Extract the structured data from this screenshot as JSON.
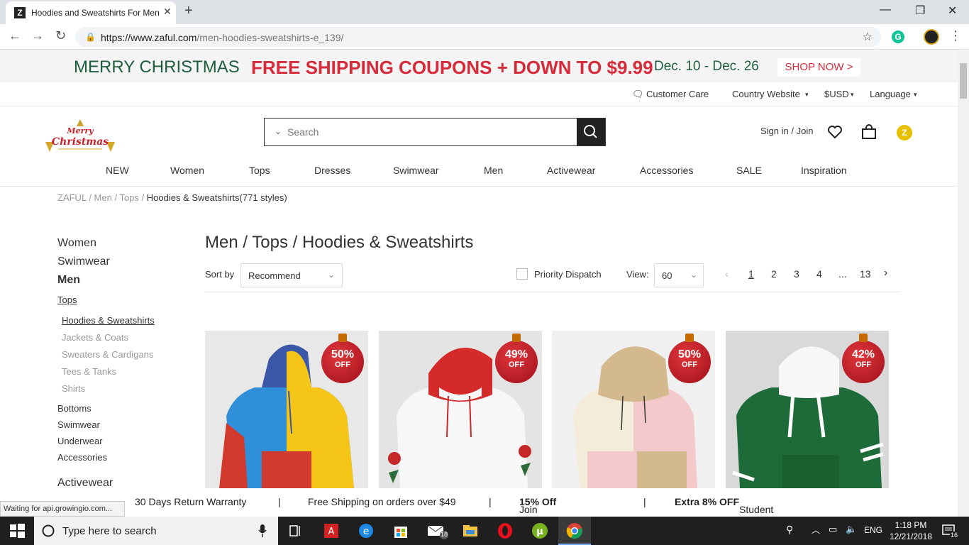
{
  "browser": {
    "tab_title": "Hoodies and Sweatshirts For Men",
    "tab_favicon": "Z",
    "url_host": "https://www.zaful.com",
    "url_path": "/men-hoodies-sweatshirts-e_139/",
    "extension_grammarly": "G"
  },
  "promo": {
    "greeting": "MERRY CHRISTMAS",
    "offer": "FREE SHIPPING COUPONS + DOWN TO $9.99",
    "dates": "Dec. 10 - Dec. 26",
    "cta": "SHOP NOW >"
  },
  "utility": {
    "customer_care": "Customer Care",
    "country": "Country Website",
    "currency": "$USD",
    "language": "Language"
  },
  "logo_text": "Merry Christmas",
  "search": {
    "placeholder": "Search"
  },
  "account": {
    "signin": "Sign in / Join",
    "points_icon": "Z"
  },
  "nav": [
    "NEW",
    "Women",
    "Tops",
    "Dresses",
    "Swimwear",
    "Men",
    "Activewear",
    "Accessories",
    "SALE",
    "Inspiration"
  ],
  "breadcrumb": {
    "home": "ZAFUL",
    "sep": " / ",
    "level1": "Men",
    "level2": "Tops",
    "current": "Hoodies & Sweatshirts(771 styles)"
  },
  "sidebar": {
    "top": [
      "Women",
      "Swimwear",
      "Men"
    ],
    "tops": "Tops",
    "tops_children": [
      "Hoodies & Sweatshirts",
      "Jackets & Coats",
      "Sweaters & Cardigans",
      "Tees & Tanks",
      "Shirts"
    ],
    "others": [
      "Bottoms",
      "Swimwear",
      "Underwear",
      "Accessories"
    ],
    "activewear": "Activewear"
  },
  "heading": "Men / Tops / Hoodies & Sweatshirts",
  "controls": {
    "sort_label": "Sort by",
    "sort_value": "Recommend",
    "priority_dispatch": "Priority Dispatch",
    "view_label": "View:",
    "view_value": "60"
  },
  "pagination": {
    "pages": [
      "1",
      "2",
      "3",
      "4",
      "...",
      "13"
    ],
    "current": "1"
  },
  "products": [
    {
      "discount": "50%",
      "off": "OFF",
      "colors": [
        "#e8e8e8",
        "#2f8fd8",
        "#f5c518",
        "#d23a2e",
        "#3a57a8"
      ]
    },
    {
      "discount": "49%",
      "off": "OFF",
      "colors": [
        "#e4e4e4",
        "#f7f7f7",
        "#d42a2a",
        "#2e6b3a",
        "#c62828"
      ]
    },
    {
      "discount": "50%",
      "off": "OFF",
      "colors": [
        "#f0f0f0",
        "#f2ecd8",
        "#f3c9cb",
        "#d4b98e",
        "#e8c8a0"
      ]
    },
    {
      "discount": "42%",
      "off": "OFF",
      "colors": [
        "#d9d9d9",
        "#1e6b3a",
        "#ffffff",
        "#1e6b3a",
        "#f7f7f7"
      ]
    }
  ],
  "footer_strip": {
    "returns": "30 Days Return Warranty",
    "shipping": "Free Shipping on orders over $49",
    "join_prefix": "Join and Get ",
    "join_bold": "15% Off",
    "student_bold": "Extra 8% OFF",
    "student_rest": " Student Discount",
    "sep": "|"
  },
  "status_bar": "Waiting for api.growingio.com...",
  "taskbar": {
    "search_placeholder": "Type here to search",
    "mail_badge": "18",
    "language": "ENG",
    "time": "1:18 PM",
    "date": "12/21/2018",
    "notifications": "16"
  }
}
